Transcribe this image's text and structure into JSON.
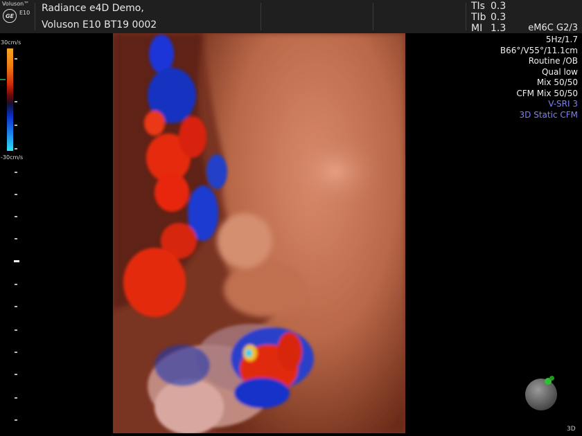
{
  "header": {
    "brand": "Voluson™",
    "model_short": "E10",
    "logo_text": "GE",
    "patient_name": "Radiance e4D Demo,",
    "device_id": "Voluson E10 BT19 0002",
    "indices": [
      {
        "label": "TIs",
        "value": "0.3"
      },
      {
        "label": "TIb",
        "value": "0.3"
      },
      {
        "label": "MI",
        "value": "1.3"
      }
    ],
    "probe": "eM6C G2/3"
  },
  "params": {
    "lines": [
      {
        "text": "5Hz/1.7",
        "color": "white"
      },
      {
        "text": "B66°/V55°/11.1cm",
        "color": "white"
      },
      {
        "text": "Routine /OB",
        "color": "white"
      },
      {
        "text": "Qual low",
        "color": "white"
      },
      {
        "text": "Mix 50/50",
        "color": "white"
      },
      {
        "text": "CFM Mix 50/50",
        "color": "white"
      },
      {
        "text": "V-SRI 3",
        "color": "blue"
      },
      {
        "text": "3D Static CFM",
        "color": "blue"
      }
    ]
  },
  "color_scale": {
    "top_label": "30cm/s",
    "bottom_label": "-30cm/s"
  },
  "viewer": {
    "mode_label": "3D",
    "colors": {
      "doppler_red": "#e8200a",
      "doppler_blue": "#1430c8",
      "skin": "#c8785a"
    }
  }
}
